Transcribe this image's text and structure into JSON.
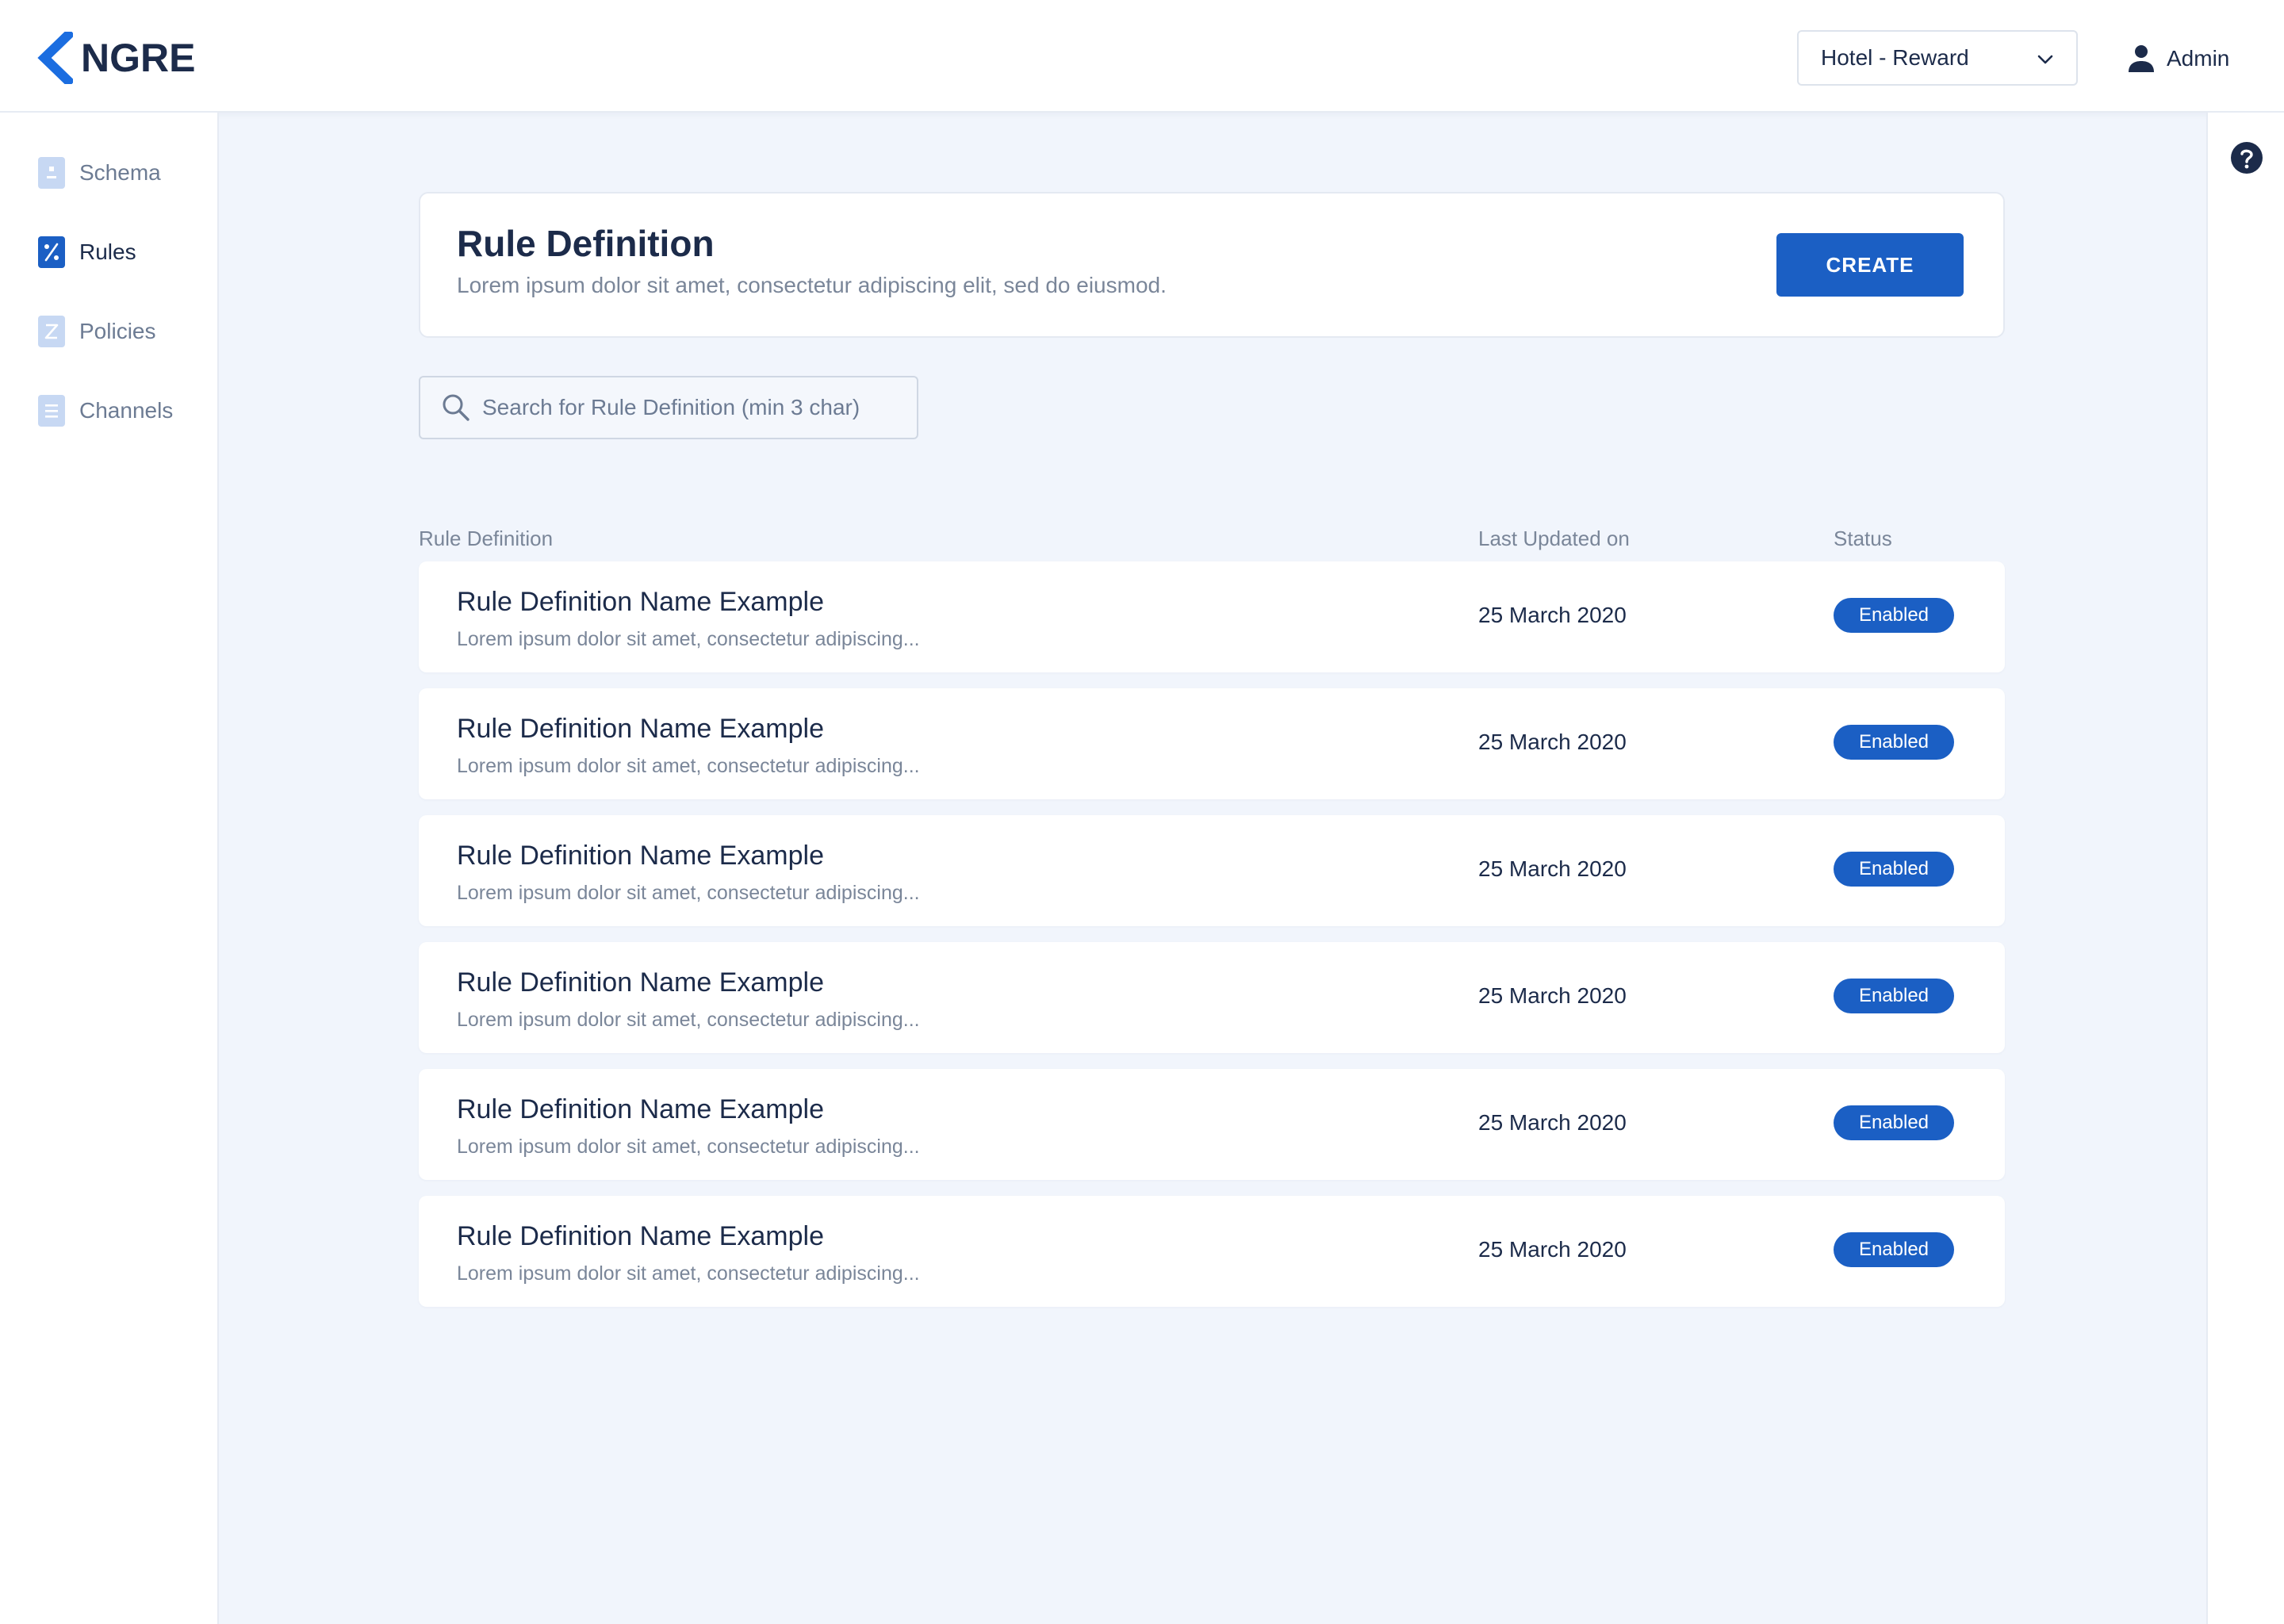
{
  "app": {
    "logo_text": "NGRE",
    "org_select_value": "Hotel - Reward",
    "user_label": "Admin"
  },
  "sidebar": {
    "items": [
      {
        "label": "Schema",
        "icon": "schema-icon",
        "active": false
      },
      {
        "label": "Rules",
        "icon": "percent-icon",
        "active": true
      },
      {
        "label": "Policies",
        "icon": "policy-icon",
        "active": false
      },
      {
        "label": "Channels",
        "icon": "document-icon",
        "active": false
      }
    ]
  },
  "intro": {
    "title": "Rule Definition",
    "subtitle": "Lorem ipsum dolor sit amet, consectetur adipiscing elit, sed do eiusmod.",
    "create_label": "CREATE"
  },
  "search": {
    "placeholder": "Search for Rule Definition (min 3 char)",
    "value": ""
  },
  "table": {
    "headers": {
      "name": "Rule Definition",
      "updated": "Last Updated on",
      "status": "Status"
    },
    "rows": [
      {
        "name": "Rule Definition Name Example",
        "desc": "Lorem ipsum dolor sit amet, consectetur adipiscing...",
        "date": "25 March 2020",
        "status": "Enabled"
      },
      {
        "name": "Rule Definition Name Example",
        "desc": "Lorem ipsum dolor sit amet, consectetur adipiscing...",
        "date": "25 March 2020",
        "status": "Enabled"
      },
      {
        "name": "Rule Definition Name Example",
        "desc": "Lorem ipsum dolor sit amet, consectetur adipiscing...",
        "date": "25 March 2020",
        "status": "Enabled"
      },
      {
        "name": "Rule Definition Name Example",
        "desc": "Lorem ipsum dolor sit amet, consectetur adipiscing...",
        "date": "25 March 2020",
        "status": "Enabled"
      },
      {
        "name": "Rule Definition Name Example",
        "desc": "Lorem ipsum dolor sit amet, consectetur adipiscing...",
        "date": "25 March 2020",
        "status": "Enabled"
      },
      {
        "name": "Rule Definition Name Example",
        "desc": "Lorem ipsum dolor sit amet, consectetur adipiscing...",
        "date": "25 March 2020",
        "status": "Enabled"
      }
    ]
  },
  "colors": {
    "accent": "#1b5fc4",
    "text": "#1c2b4a",
    "muted": "#7a8699",
    "background": "#f1f5fc",
    "inactive_icon": "#c7d8f3"
  }
}
